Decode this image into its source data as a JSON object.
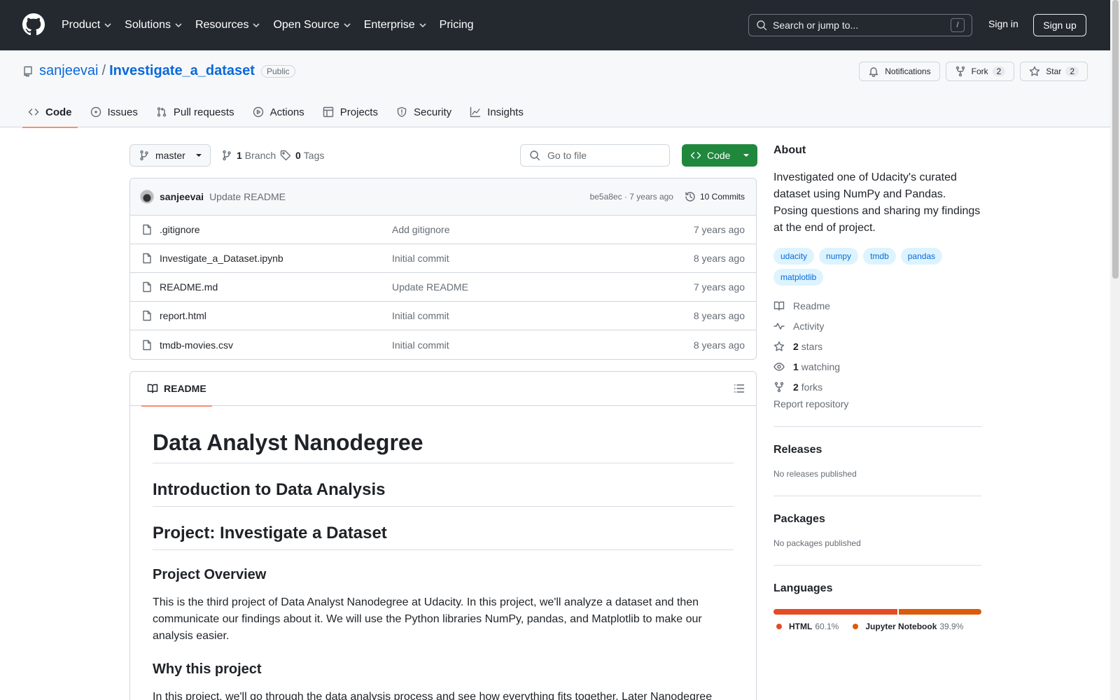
{
  "header": {
    "nav": [
      "Product",
      "Solutions",
      "Resources",
      "Open Source",
      "Enterprise",
      "Pricing"
    ],
    "search_placeholder": "Search or jump to...",
    "search_shortcut": "/",
    "signin": "Sign in",
    "signup": "Sign up"
  },
  "repo": {
    "owner": "sanjeevai",
    "name": "Investigate_a_dataset",
    "visibility": "Public",
    "notifications": "Notifications",
    "fork_label": "Fork",
    "fork_count": "2",
    "star_label": "Star",
    "star_count": "2",
    "tabs": [
      "Code",
      "Issues",
      "Pull requests",
      "Actions",
      "Projects",
      "Security",
      "Insights"
    ]
  },
  "filebar": {
    "branch": "master",
    "branch_count": "1",
    "branch_label": "Branch",
    "tag_count": "0",
    "tag_label": "Tags",
    "goto_placeholder": "Go to file",
    "code_button": "Code"
  },
  "commit": {
    "author": "sanjeevai",
    "message": "Update README",
    "hash_time": "be5a8ec · 7 years ago",
    "commits": "10 Commits"
  },
  "files": [
    {
      "name": ".gitignore",
      "message": "Add gitignore",
      "time": "7 years ago"
    },
    {
      "name": "Investigate_a_Dataset.ipynb",
      "message": "Initial commit",
      "time": "8 years ago"
    },
    {
      "name": "README.md",
      "message": "Update README",
      "time": "7 years ago"
    },
    {
      "name": "report.html",
      "message": "Initial commit",
      "time": "8 years ago"
    },
    {
      "name": "tmdb-movies.csv",
      "message": "Initial commit",
      "time": "8 years ago"
    }
  ],
  "readme": {
    "tab": "README",
    "h1": "Data Analyst Nanodegree",
    "h2a": "Introduction to Data Analysis",
    "h2b": "Project: Investigate a Dataset",
    "h3a": "Project Overview",
    "p1": "This is the third project of Data Analyst Nanodegree at Udacity. In this project, we'll analyze a dataset and then communicate our findings about it. We will use the Python libraries NumPy, pandas, and Matplotlib to make our analysis easier.",
    "h3b": "Why this project",
    "p2": "In this project, we'll go through the data analysis process and see how everything fits together. Later Nanodegree"
  },
  "about": {
    "title": "About",
    "description": "Investigated one of Udacity's curated dataset using NumPy and Pandas. Posing questions and sharing my findings at the end of project.",
    "topics": [
      "udacity",
      "numpy",
      "tmdb",
      "pandas",
      "matplotlib"
    ],
    "readme": "Readme",
    "activity": "Activity",
    "stars_count": "2",
    "stars_label": "stars",
    "watching_count": "1",
    "watching_label": "watching",
    "forks_count": "2",
    "forks_label": "forks",
    "report": "Report repository"
  },
  "releases": {
    "title": "Releases",
    "text": "No releases published"
  },
  "packages": {
    "title": "Packages",
    "text": "No packages published"
  },
  "languages": {
    "title": "Languages",
    "items": [
      {
        "name": "HTML",
        "pct": "60.1%",
        "color": "#e34c26",
        "value": 60.1
      },
      {
        "name": "Jupyter Notebook",
        "pct": "39.9%",
        "color": "#DA5B0B",
        "value": 39.9
      }
    ]
  }
}
